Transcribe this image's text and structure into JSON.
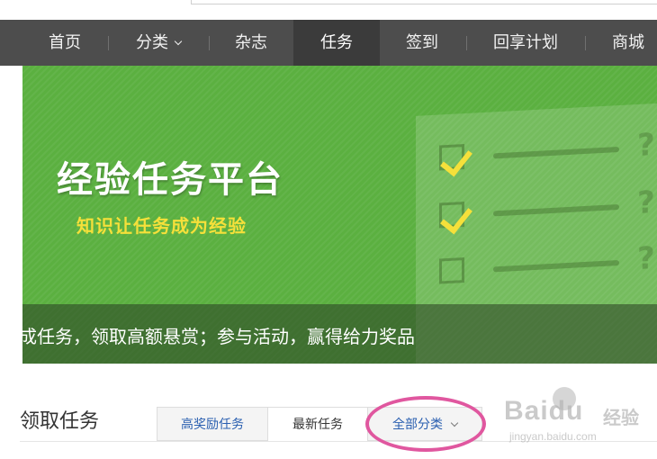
{
  "nav": {
    "items": [
      {
        "label": "首页"
      },
      {
        "label": "分类",
        "has_dropdown": true
      },
      {
        "label": "杂志"
      },
      {
        "label": "任务",
        "active": true
      },
      {
        "label": "签到"
      },
      {
        "label": "回享计划"
      },
      {
        "label": "商城"
      }
    ]
  },
  "banner": {
    "title": "经验任务平台",
    "subtitle": "知识让任务成为经验",
    "strip_text": "成任务，领取高额悬赏；参与活动，赢得给力奖品",
    "checklist_marks": [
      "?",
      "?",
      "?"
    ]
  },
  "section": {
    "title": "领取任务",
    "tabs": [
      {
        "label": "高奖励任务"
      },
      {
        "label": "最新任务"
      },
      {
        "label": "全部分类"
      }
    ]
  },
  "watermark": {
    "logo": "Baidu",
    "product": "经验",
    "url": "jingyan.baidu.com"
  },
  "colors": {
    "nav_bg": "#4d4d4d",
    "nav_active_bg": "#3b3b3b",
    "banner_green": "#5bb040",
    "subtitle_yellow": "#f5e03a",
    "tab_link_blue": "#2a5fb0",
    "highlight_pink": "#e0579f"
  }
}
